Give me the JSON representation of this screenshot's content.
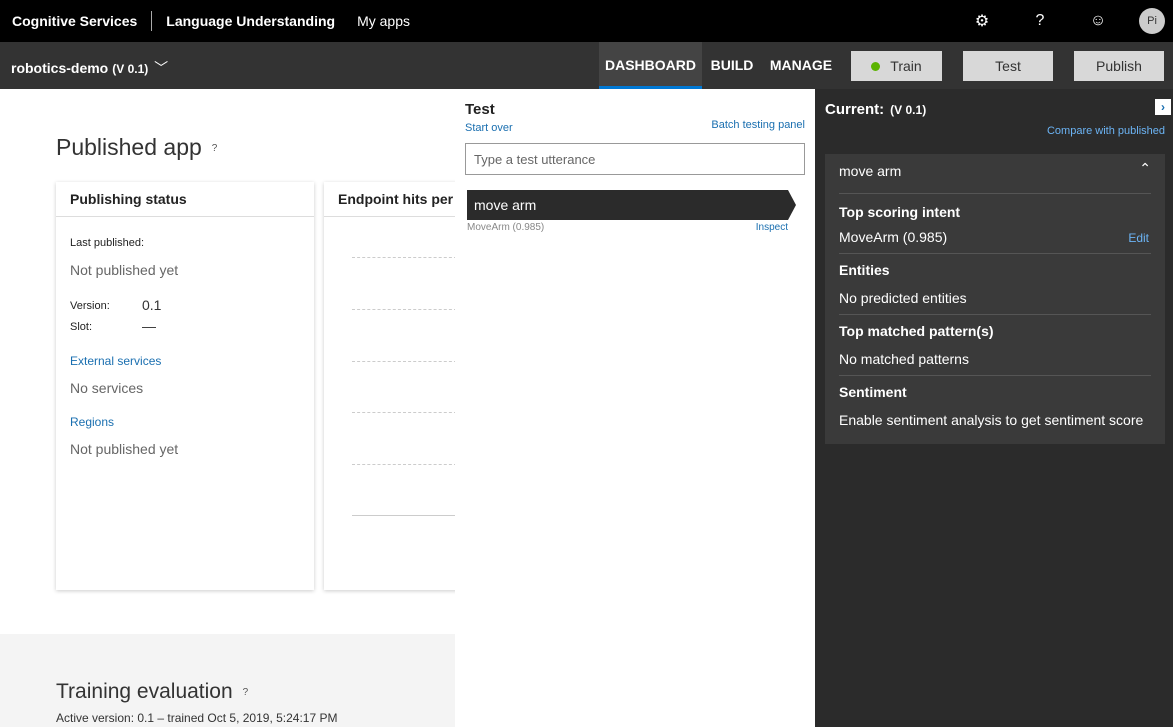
{
  "topbar": {
    "brand": "Cognitive Services",
    "product": "Language Understanding",
    "my_apps": "My apps",
    "settings_icon": "⚙",
    "help_icon": "?",
    "feedback_icon": "☺",
    "avatar_initials": "Pi"
  },
  "appbar": {
    "app_name": "robotics-demo",
    "version": "(V 0.1)",
    "nav": {
      "dashboard": "DASHBOARD",
      "build": "BUILD",
      "manage": "MANAGE"
    },
    "buttons": {
      "train": "Train",
      "test": "Test",
      "publish": "Publish"
    }
  },
  "dashboard": {
    "published_title": "Published app",
    "help_mark": "?",
    "publishing_status": {
      "header": "Publishing status",
      "last_published_label": "Last published:",
      "last_published_value": "Not published yet",
      "version_label": "Version:",
      "version_value": "0.1",
      "slot_label": "Slot:",
      "slot_value": "—",
      "external_services_label": "External services",
      "external_services_value": "No services",
      "regions_label": "Regions",
      "regions_value": "Not published yet"
    },
    "endpoint_hits": {
      "header": "Endpoint hits per"
    },
    "training": {
      "title": "Training evaluation",
      "subtitle": "Active version: 0.1 – trained Oct 5, 2019, 5:24:17 PM"
    }
  },
  "test_panel": {
    "title": "Test",
    "start_over": "Start over",
    "batch_testing": "Batch testing panel",
    "input_placeholder": "Type a test utterance",
    "utterance": "move arm",
    "utterance_result": "MoveArm (0.985)",
    "inspect": "Inspect"
  },
  "inspect_panel": {
    "current_label": "Current:",
    "current_version": "(V 0.1)",
    "expand_icon": "›",
    "compare_link": "Compare with published",
    "utterance": "move arm",
    "collapse_icon": "⌃",
    "top_scoring_intent_label": "Top scoring intent",
    "top_scoring_intent_value": "MoveArm (0.985)",
    "edit": "Edit",
    "entities_label": "Entities",
    "entities_value": "No predicted entities",
    "patterns_label": "Top matched pattern(s)",
    "patterns_value": "No matched patterns",
    "sentiment_label": "Sentiment",
    "sentiment_value": "Enable sentiment analysis to get sentiment score"
  }
}
